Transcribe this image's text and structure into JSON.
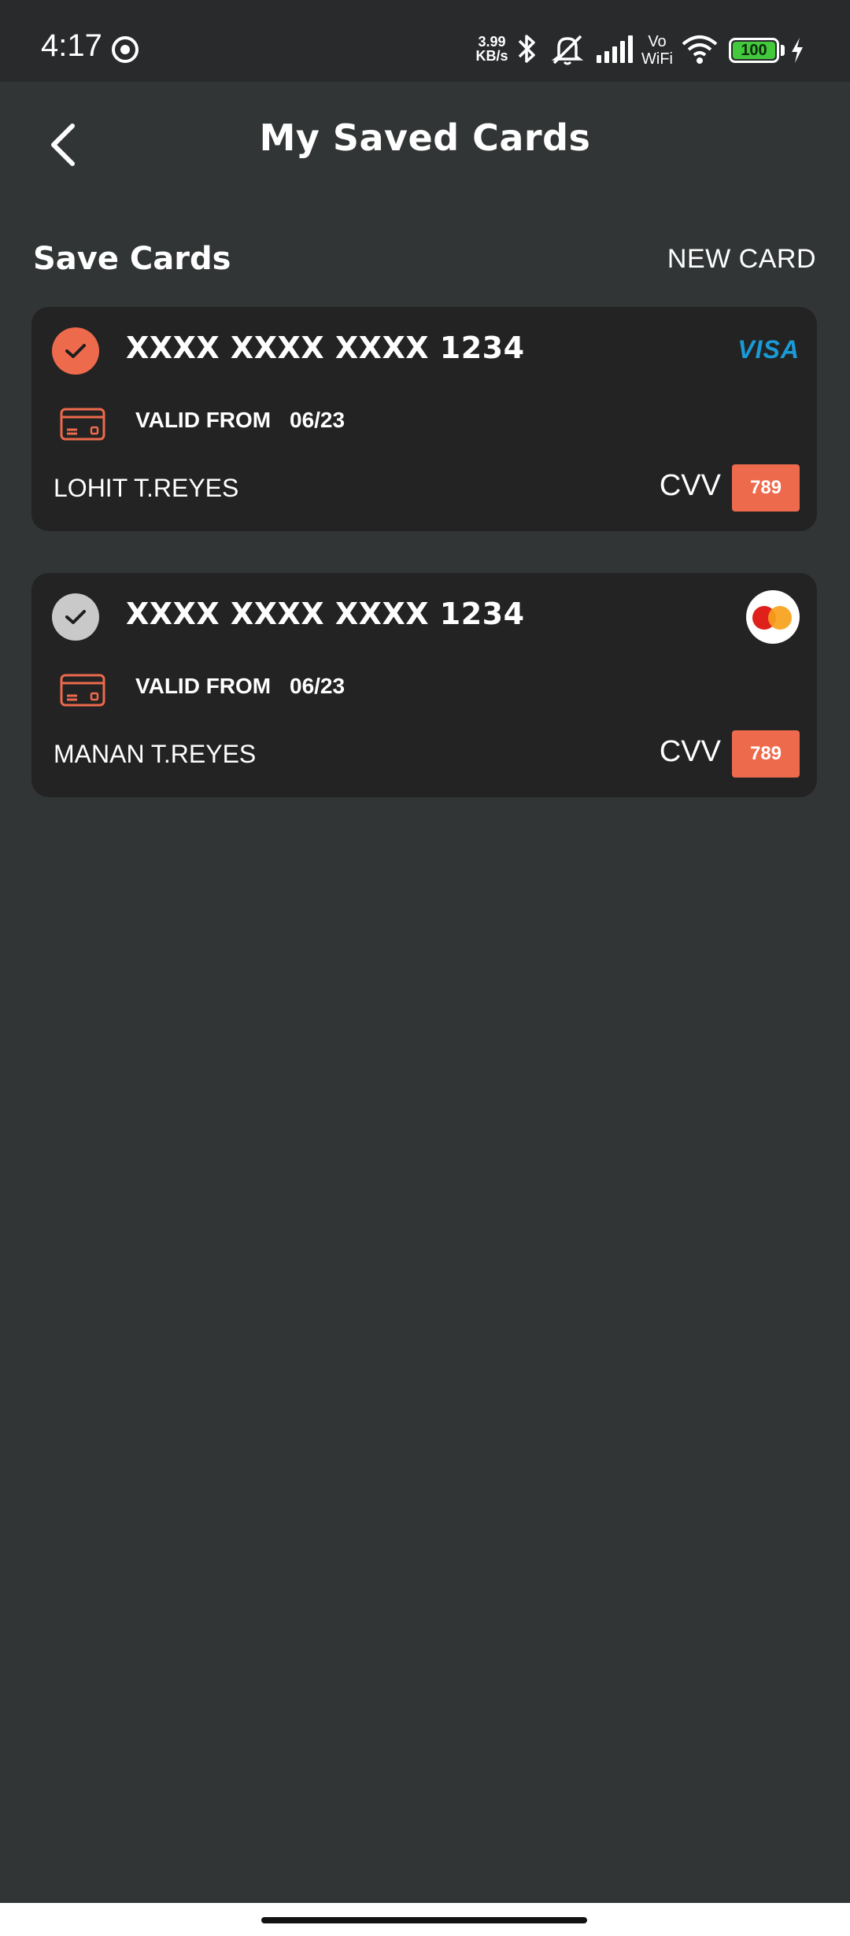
{
  "status_bar": {
    "time": "4:17",
    "net_speed_value": "3.99",
    "net_speed_unit": "KB/s",
    "vowifi_top": "Vo",
    "vowifi_bottom": "WiFi",
    "battery": "100"
  },
  "header": {
    "title": "My Saved Cards",
    "back_icon": "chevron-left-icon"
  },
  "section": {
    "title": "Save Cards",
    "new_card_label": "NEW CARD"
  },
  "cards": [
    {
      "number": "XXXX XXXX XXXX 1234",
      "brand": "VISA",
      "valid_label": "VALID FROM",
      "valid_date": "06/23",
      "holder": "LOHIT T.REYES",
      "cvv_label": "CVV",
      "cvv": "789",
      "selected": true
    },
    {
      "number": "XXXX XXXX XXXX 1234",
      "brand": "MasterCard",
      "valid_label": "VALID FROM",
      "valid_date": "06/23",
      "holder": "MANAN T.REYES",
      "cvv_label": "CVV",
      "cvv": "789",
      "selected": false
    }
  ],
  "colors": {
    "background": "#323535",
    "card": "#232323",
    "accent": "#ee6a4c",
    "unselected": "#c9c9c9",
    "visa": "#1a9bd7"
  }
}
